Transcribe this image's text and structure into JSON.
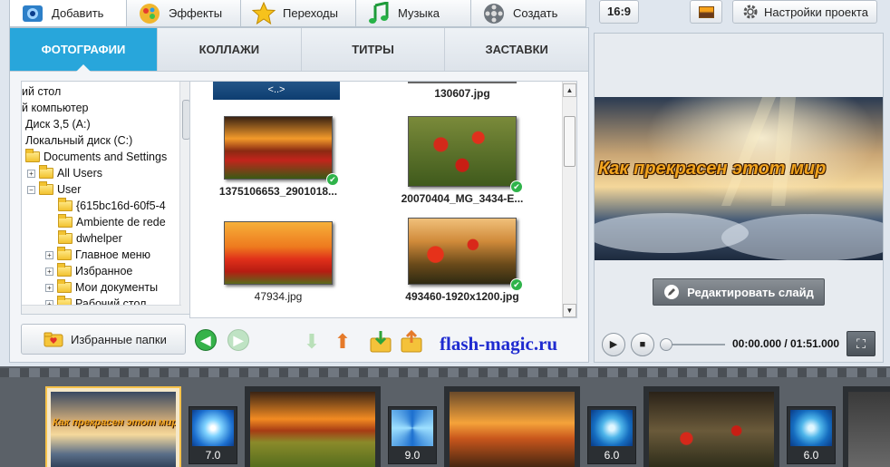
{
  "top_tabs": [
    {
      "label": "Добавить",
      "icon": "add-icon",
      "active": true
    },
    {
      "label": "Эффекты",
      "icon": "effects-icon"
    },
    {
      "label": "Переходы",
      "icon": "star-icon"
    },
    {
      "label": "Музыка",
      "icon": "music-note-icon"
    },
    {
      "label": "Создать",
      "icon": "film-reel-icon"
    }
  ],
  "sub_tabs": [
    {
      "label": "ФОТОГРАФИИ",
      "active": true
    },
    {
      "label": "КОЛЛАЖИ"
    },
    {
      "label": "ТИТРЫ"
    },
    {
      "label": "ЗАСТАВКИ"
    }
  ],
  "tree": {
    "items": [
      {
        "label": "ий стол",
        "indent": 0
      },
      {
        "label": "й компьютер",
        "indent": 0
      },
      {
        "label": "Диск 3,5 (A:)",
        "indent": 0
      },
      {
        "label": "Локальный диск (C:)",
        "indent": 0
      },
      {
        "label": "Documents and Settings",
        "indent": 0,
        "folder": true
      },
      {
        "label": "All Users",
        "indent": 1,
        "folder": true,
        "expander": "+"
      },
      {
        "label": "User",
        "indent": 1,
        "folder": true,
        "expander": "−"
      },
      {
        "label": "{615bc16d-60f5-4",
        "indent": 2,
        "folder": true
      },
      {
        "label": "Ambiente de rede",
        "indent": 2,
        "folder": true
      },
      {
        "label": "dwhelper",
        "indent": 2,
        "folder": true
      },
      {
        "label": "Главное меню",
        "indent": 2,
        "folder": true,
        "expander": "+"
      },
      {
        "label": "Избранное",
        "indent": 2,
        "folder": true,
        "expander": "+"
      },
      {
        "label": "Мои документы",
        "indent": 2,
        "folder": true,
        "expander": "+"
      },
      {
        "label": "Рабочий стол",
        "indent": 2,
        "folder": true,
        "expander": "+"
      }
    ]
  },
  "thumbs": {
    "top_row": [
      {
        "name": "<..>"
      },
      {
        "name": "130607.jpg"
      }
    ],
    "items": [
      {
        "name": "1375106653_2901018...",
        "checked": true
      },
      {
        "name": "20070404_MG_3434-E...",
        "checked": true
      },
      {
        "name": "47934.jpg",
        "checked": false
      },
      {
        "name": "493460-1920x1200.jpg",
        "checked": true
      }
    ]
  },
  "bottom_left": {
    "favorites_label": "Избранные папки",
    "watermark": "flash-magic.ru"
  },
  "right": {
    "ratio": "16:9",
    "settings_label": "Настройки проекта",
    "preview_title": "Как  прекрасен этот мир",
    "edit_label": "Редактировать слайд",
    "time": "00:00.000 / 01:51.000"
  },
  "filmstrip": {
    "slide_caption": "Как прекрасен этот мир",
    "transitions": [
      "7.0",
      "9.0",
      "6.0",
      "6.0"
    ]
  },
  "colors": {
    "accent": "#28a6db",
    "watermark": "#1f2bd0",
    "title_text": "#f2a51f"
  }
}
